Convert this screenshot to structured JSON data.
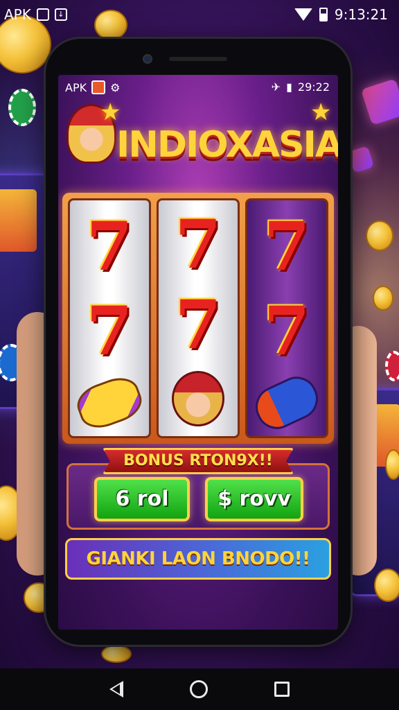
{
  "outer_status": {
    "carrier_label": "APK",
    "time": "9:13:21"
  },
  "inner_status": {
    "carrier_label": "APK",
    "time": "29:22"
  },
  "game": {
    "title": "INDIOXASIA",
    "reels": [
      {
        "symbols": [
          "7",
          "7",
          "candy-symbol"
        ]
      },
      {
        "symbols": [
          "7",
          "7",
          "character-symbol"
        ]
      },
      {
        "symbols": [
          "7",
          "7",
          "rocket-symbol"
        ]
      }
    ],
    "bonus_banner": "BONUS RTON9X!!",
    "buttons": [
      {
        "label": "6 rol"
      },
      {
        "label": "$ rovv"
      }
    ],
    "claim_label": "GIANKI LAON  BNODO!!"
  },
  "nav_bar": {
    "icons": [
      "back-icon",
      "home-icon",
      "recents-icon"
    ]
  },
  "colors": {
    "accent_gold": "#ffd43b",
    "button_green": "#12a312",
    "seven_red": "#e8231f"
  }
}
